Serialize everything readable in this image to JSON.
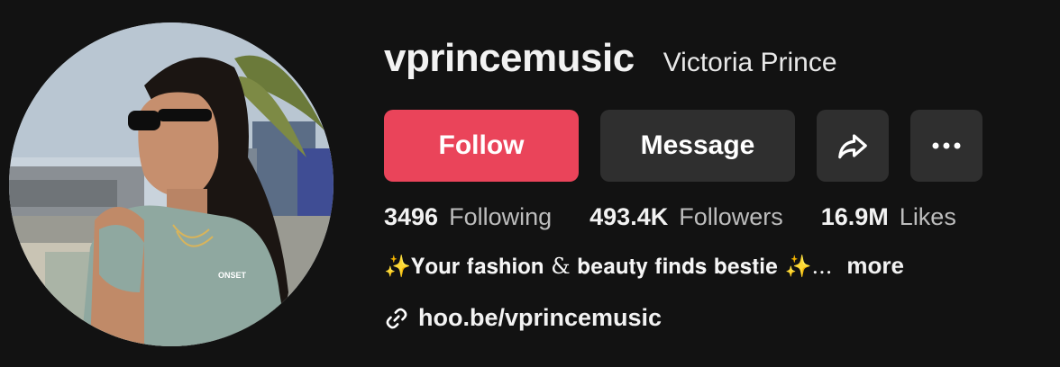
{
  "profile": {
    "username": "vprincemusic",
    "display_name": "Victoria Prince",
    "avatar_alt": "avatar"
  },
  "buttons": {
    "follow_label": "Follow",
    "message_label": "Message",
    "share_icon": "share-icon",
    "more_icon": "more-icon"
  },
  "stats": [
    {
      "value": "3496",
      "label": "Following"
    },
    {
      "value": "493.4K",
      "label": "Followers"
    },
    {
      "value": "16.9M",
      "label": "Likes"
    }
  ],
  "bio": {
    "text": "✨𝐘𝐨𝐮𝐫 𝐟𝐚𝐬𝐡𝐢𝐨𝐧 & 𝐛𝐞𝐚𝐮𝐭𝐲 𝐟𝐢𝐧𝐝𝐬 𝐛𝐞𝐬𝐭𝐢𝐞 ✨...",
    "more_label": "more"
  },
  "link": {
    "text": "hoo.be/vprincemusic",
    "icon": "link-icon"
  },
  "colors": {
    "background": "#121212",
    "follow": "#ea445a",
    "secondary_button": "#2f2f2f"
  }
}
